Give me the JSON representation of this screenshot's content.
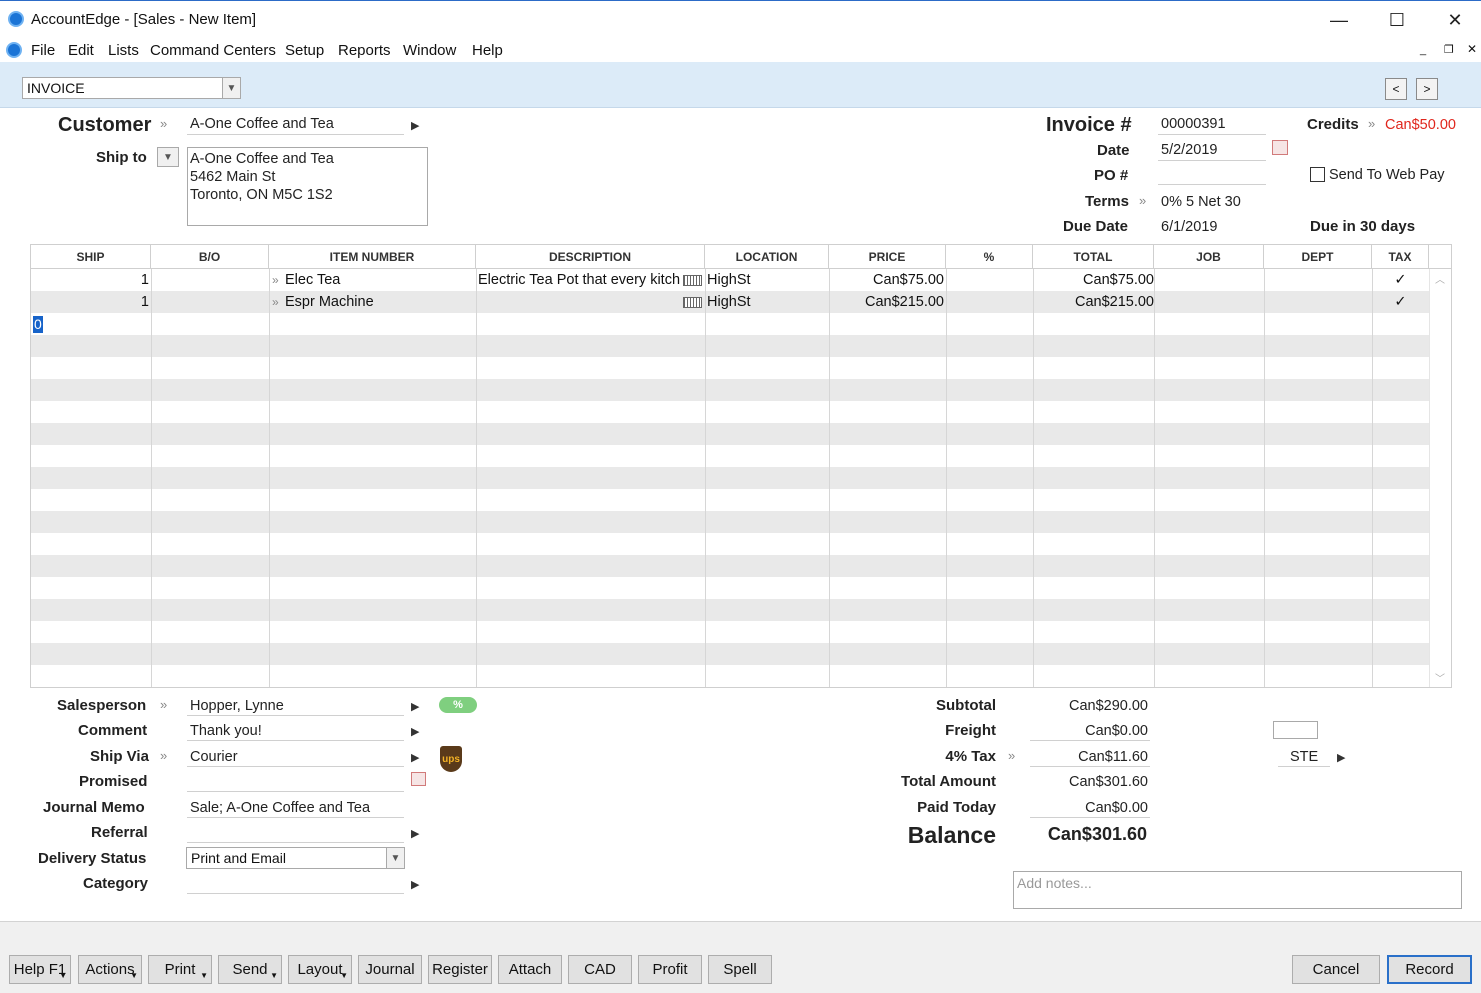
{
  "window": {
    "title": "AccountEdge - [Sales - New Item]",
    "minimize_glyph": "—",
    "maximize_glyph": "☐",
    "close_glyph": "✕"
  },
  "menu": {
    "items": [
      "File",
      "Edit",
      "Lists",
      "Command Centers",
      "Setup",
      "Reports",
      "Window",
      "Help"
    ]
  },
  "toolbar": {
    "layout_type": "INVOICE",
    "prev_glyph": "<",
    "next_glyph": ">"
  },
  "header": {
    "customer_label": "Customer",
    "customer_value": "A-One Coffee and Tea",
    "ship_to_label": "Ship to",
    "ship_to_lines": [
      "A-One Coffee and Tea",
      "5462 Main St",
      "Toronto, ON M5C 1S2"
    ],
    "invoice_label": "Invoice #",
    "invoice_value": "00000391",
    "date_label": "Date",
    "date_value": "5/2/2019",
    "po_label": "PO #",
    "po_value": "",
    "terms_label": "Terms",
    "terms_value": "0% 5 Net 30",
    "due_date_label": "Due Date",
    "due_date_value": "6/1/2019",
    "due_in": "Due in 30 days",
    "credits_label": "Credits",
    "credits_value": "Can$50.00",
    "web_pay_label": "Send To Web Pay"
  },
  "grid": {
    "columns": [
      "SHIP",
      "B/O",
      "ITEM NUMBER",
      "DESCRIPTION",
      "LOCATION",
      "PRICE",
      "%",
      "TOTAL",
      "JOB",
      "DEPT",
      "TAX"
    ],
    "rows": [
      {
        "ship": "1",
        "bo": "",
        "item": "Elec Tea",
        "description": "Electric Tea Pot that every kitch",
        "location": "HighSt",
        "price": "Can$75.00",
        "pct": "",
        "total": "Can$75.00",
        "job": "",
        "dept": "",
        "tax": "✓"
      },
      {
        "ship": "1",
        "bo": "",
        "item": "Espr Machine",
        "description": "",
        "location": "HighSt",
        "price": "Can$215.00",
        "pct": "",
        "total": "Can$215.00",
        "job": "",
        "dept": "",
        "tax": "✓"
      }
    ],
    "active_cell_value": "0"
  },
  "footer_fields": {
    "salesperson_label": "Salesperson",
    "salesperson_value": "Hopper, Lynne",
    "comment_label": "Comment",
    "comment_value": "Thank you!",
    "ship_via_label": "Ship Via",
    "ship_via_value": "Courier",
    "promised_label": "Promised",
    "promised_value": "",
    "journal_memo_label": "Journal Memo",
    "journal_memo_value": "Sale; A-One Coffee and Tea",
    "referral_label": "Referral",
    "referral_value": "",
    "delivery_status_label": "Delivery Status",
    "delivery_status_value": "Print and Email",
    "category_label": "Category",
    "category_value": "",
    "ups_text": "ups",
    "percent_badge": "%"
  },
  "totals": {
    "subtotal_label": "Subtotal",
    "subtotal_value": "Can$290.00",
    "freight_label": "Freight",
    "freight_value": "Can$0.00",
    "tax_label": "4% Tax",
    "tax_value": "Can$11.60",
    "tax_code": "STE",
    "total_amount_label": "Total Amount",
    "total_amount_value": "Can$301.60",
    "paid_today_label": "Paid Today",
    "paid_today_value": "Can$0.00",
    "balance_label": "Balance",
    "balance_value": "Can$301.60",
    "notes_placeholder": "Add notes..."
  },
  "buttons": {
    "help": "Help F1",
    "actions": "Actions",
    "print": "Print",
    "send": "Send",
    "layout": "Layout",
    "journal": "Journal",
    "register": "Register",
    "attach": "Attach",
    "cad": "CAD",
    "profit": "Profit",
    "spell": "Spell",
    "cancel": "Cancel",
    "record": "Record"
  },
  "colors": {
    "toolbar_bg": "#dcebf8",
    "credits_red": "#e0261c",
    "badge_green": "#7fcf7f",
    "record_border": "#2a70c9"
  }
}
